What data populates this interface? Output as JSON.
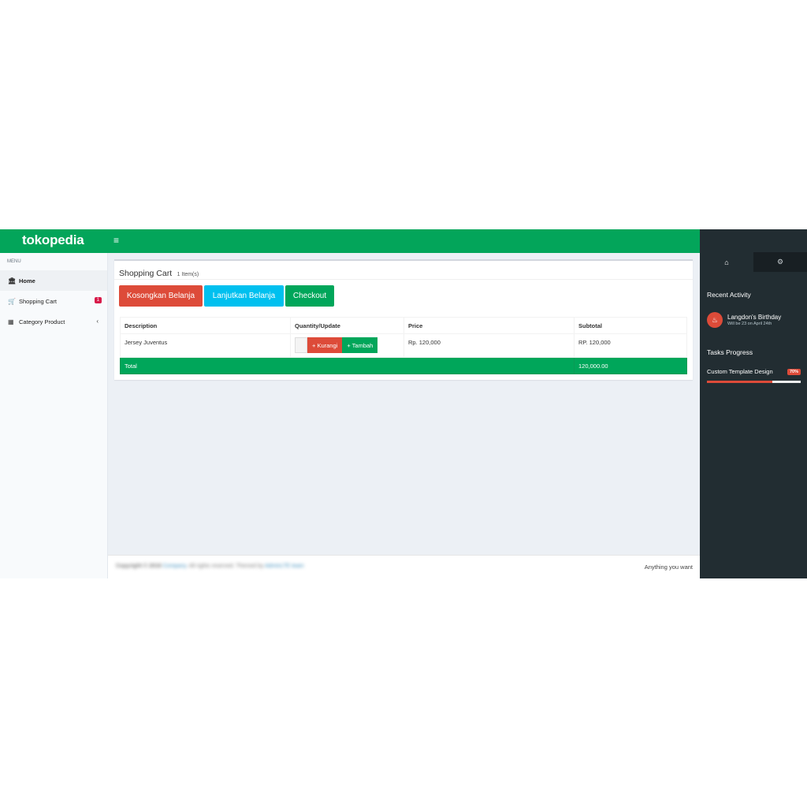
{
  "header": {
    "logo": "tokopedia",
    "menu_toggle": "≡"
  },
  "sidebar": {
    "menu_label": "MENU",
    "items": [
      {
        "label": "Home",
        "icon": "bank-icon"
      },
      {
        "label": "Shopping Cart",
        "icon": "cart-icon",
        "badge": "1"
      },
      {
        "label": "Category Product",
        "icon": "grid-icon",
        "chevron": "‹"
      }
    ]
  },
  "cart": {
    "title": "Shopping Cart",
    "subtitle": "1 Item(s)",
    "buttons": {
      "empty": "Kosongkan Belanja",
      "continue": "Lanjutkan Belanja",
      "checkout": "Checkout"
    },
    "columns": [
      "Description",
      "Quantity/Update",
      "Price",
      "Subtotal"
    ],
    "rows": [
      {
        "description": "Jersey Juventus",
        "quantity": "",
        "reduce": "+ Kurangi",
        "add": "+ Tambah",
        "price": "Rp. 120,000",
        "subtotal": "RP. 120,000"
      }
    ],
    "total_label": "Total",
    "total_value": "120,000.00"
  },
  "footer": {
    "copyright": "Copyright © 2018",
    "company": "Company",
    "rights": ". All rights reserved. Themed by",
    "theme": "AdminLTE team",
    "tagline": "Anything you want"
  },
  "control_sidebar": {
    "tabs": [
      {
        "icon": "home-icon",
        "glyph": "⌂"
      },
      {
        "icon": "gears-icon",
        "glyph": "⚙"
      }
    ],
    "recent_activity_heading": "Recent Activity",
    "activity": {
      "title": "Langdon's Birthday",
      "subtitle": "Will be 23 on April 24th",
      "glyph": "♨"
    },
    "tasks_heading": "Tasks Progress",
    "task": {
      "label": "Custom Template Design",
      "percent_label": "70%",
      "progress": 0.7
    }
  },
  "colors": {
    "brand_green": "#03a55a",
    "danger": "#dd4b39",
    "info": "#00c0ef",
    "success": "#00a65a",
    "dark": "#222d32"
  }
}
